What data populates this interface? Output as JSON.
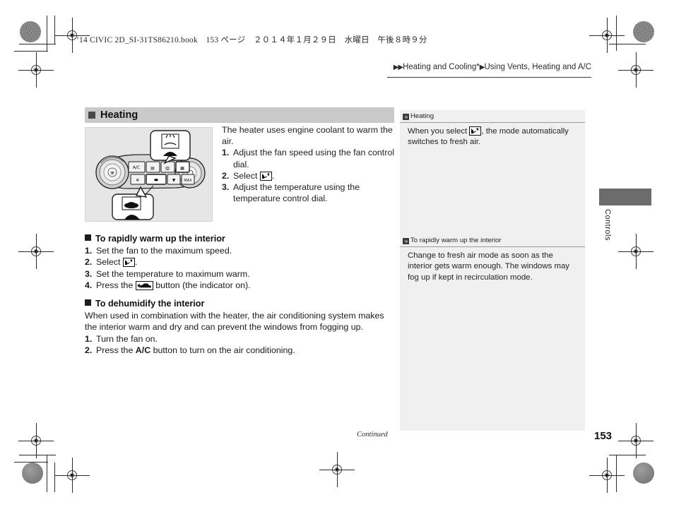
{
  "book_header": "’14 CIVIC 2D_SI-31TS86210.book　153 ページ　２０１４年１月２９日　水曜日　午後８時９分",
  "breadcrumb": {
    "arrow_double": "▶▶",
    "parent": "Heating and Cooling",
    "asterisk": "*",
    "arrow_single": "▶",
    "current": "Using Vents, Heating and A/C"
  },
  "section": {
    "title": "Heating",
    "intro": "The heater uses engine coolant to warm the air.",
    "steps": [
      {
        "n": "1.",
        "pre": "Adjust the fan speed using the fan control dial.",
        "icon": "",
        "post": ""
      },
      {
        "n": "2.",
        "pre": "Select ",
        "icon": "mode-floor-icon",
        "post": "."
      },
      {
        "n": "3.",
        "pre": "Adjust the temperature using the temperature control dial.",
        "icon": "",
        "post": ""
      }
    ]
  },
  "rapid_warm": {
    "title": "To rapidly warm up the interior",
    "steps": [
      {
        "n": "1.",
        "pre": "Set the fan to the maximum speed.",
        "icon": "",
        "post": ""
      },
      {
        "n": "2.",
        "pre": "Select ",
        "icon": "mode-floor-icon",
        "post": "."
      },
      {
        "n": "3.",
        "pre": "Set the temperature to maximum warm.",
        "icon": "",
        "post": ""
      },
      {
        "n": "4.",
        "pre": "Press the ",
        "icon": "recirculation-icon",
        "post": " button (the indicator on)."
      }
    ]
  },
  "dehumidify": {
    "title": "To dehumidify the interior",
    "intro": "When used in combination with the heater, the air conditioning system makes the interior warm and dry and can prevent the windows from fogging up.",
    "steps": [
      {
        "n": "1.",
        "pre": "Turn the fan on.",
        "bold": "",
        "post": ""
      },
      {
        "n": "2.",
        "pre": "Press the ",
        "bold": "A/C",
        "post": " button to turn on the air conditioning."
      }
    ]
  },
  "sidebar": {
    "note1": {
      "heading": "Heating",
      "chevron": "»",
      "text_pre": "When you select ",
      "icon": "mode-floor-icon",
      "text_post": ", the mode automatically switches to fresh air."
    },
    "note2": {
      "heading": "To rapidly warm up the interior",
      "chevron": "»",
      "text": "Change to fresh air mode as soon as the interior gets warm enough. The windows may fog up if kept in recirculation mode."
    }
  },
  "edge_tab": {
    "label": "Controls"
  },
  "footer": {
    "continued": "Continued",
    "page_number": "153"
  },
  "figure": {
    "caption": "climate-control-panel-illustration",
    "callout_top": "face-vent-mode-callout",
    "callout_bottom": "recirculation-button-callout"
  },
  "colors": {
    "section_head_bg": "#c9c9c9",
    "sidebar_bg": "#f0f0f0",
    "tab_block": "#6c6c6c",
    "figure_bg": "#e6e6e6"
  }
}
